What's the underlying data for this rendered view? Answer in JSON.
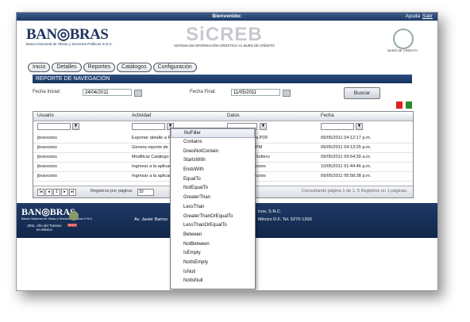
{
  "topbar": {
    "welcome": "Bienvenido:",
    "help": "Ayuda",
    "logout": "Salir"
  },
  "header": {
    "brand": "BAN◎BRAS",
    "brand_sub": "Banco Nacional de Obras y Servicios Públicos S.N.C.",
    "app_name": "SiCREB",
    "app_sub": "SISTEMA DE INFORMACIÓN CREDITICIA AL BURÓ DE CRÉDITO",
    "buro_label": "BURÓ DE CRÉDITO"
  },
  "nav": {
    "tabs": [
      "Inicio",
      "Detalles",
      "Reportes",
      "Catálogos",
      "Configuración"
    ]
  },
  "page": {
    "title": "REPORTE DE NAVEGACIÓN"
  },
  "filters": {
    "start_label": "Fecha Inicial:",
    "start_value": "24/04/2011",
    "end_label": "Fecha Final:",
    "end_value": "11/05/2011",
    "search_button": "Buscar"
  },
  "grid": {
    "columns": [
      "Usuario",
      "Actividad",
      "Datos",
      "Fecha"
    ],
    "rows": [
      {
        "usuario": "jbravozws",
        "actividad": "Exportar detalle a P",
        "datos": "a PDF",
        "fecha": "09/05/2011 04:12:17 p.m."
      },
      {
        "usuario": "jbravozws",
        "actividad": "Genera reporte de",
        "datos": "PM",
        "fecha": "09/05/2011 04:13:25 p.m."
      },
      {
        "usuario": "jbravozws",
        "actividad": "Modificar Catálogo",
        "datos": "Soltero",
        "fecha": "09/05/2011 09:54:30 a.m."
      },
      {
        "usuario": "jbravozws",
        "actividad": "Ingresar a la aplicac",
        "datos": "ozws",
        "fecha": "10/05/2011 01:44:46 p.m."
      },
      {
        "usuario": "jbravozws",
        "actividad": "Ingresar a la aplicac",
        "datos": "ozws",
        "fecha": "09/05/2011 05:58:38 p.m."
      }
    ],
    "pager": {
      "page": "1",
      "page_size_label": "Registros por página:",
      "page_size": "10",
      "summary": "Consultando página 1 de 1. 5 Registros en 1 páginas."
    }
  },
  "filter_menu": {
    "options": [
      "NoFilter",
      "Contains",
      "DoesNotContain",
      "StartsWith",
      "EndsWith",
      "EqualTo",
      "NotEqualTo",
      "GreaterThan",
      "LessThan",
      "GreaterThanOrEqualTo",
      "LessThanOrEqualTo",
      "Between",
      "NotBetween",
      "IsEmpty",
      "NotIsEmpty",
      "IsNull",
      "NotIsNull"
    ],
    "selected": "NoFilter"
  },
  "footer": {
    "brand": "BAN◎BRAS",
    "brand_sub": "Banco Nacional de Obras y Servicios Públicos S.N.C.",
    "year_text": "2011, Año del Turismo en México",
    "shcp": "SHCP",
    "line_top": "B",
    "company_tail": "icos, S.N.C.",
    "address_a": "Av. Javier Barros",
    "address_b": "México D.F. Tel. 5270-1200"
  }
}
